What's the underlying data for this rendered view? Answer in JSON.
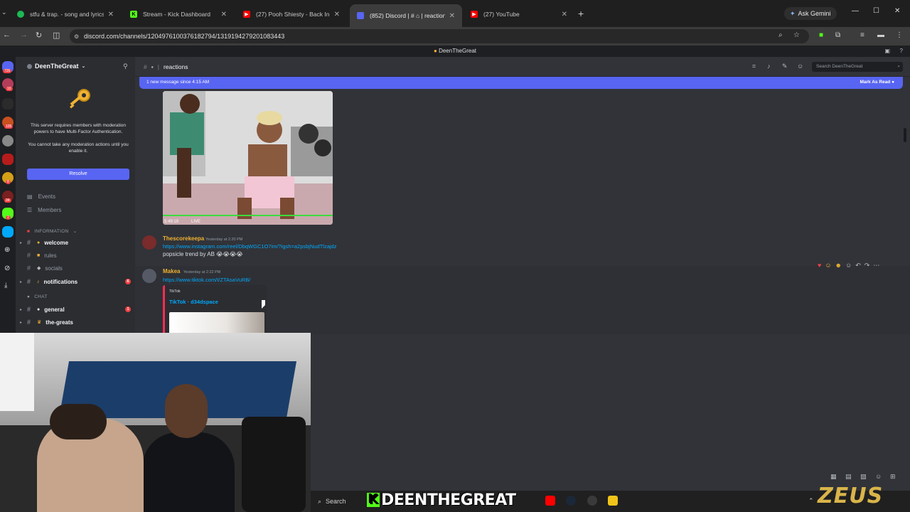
{
  "browser": {
    "tabs": [
      {
        "label": "stfu & trap. - song and lyrics by",
        "color": "#1db954"
      },
      {
        "label": "Stream - Kick Dashboard",
        "color": "#53fc18"
      },
      {
        "label": "(27) Pooh Shiesty - Back In Bloo",
        "color": "#ff0000"
      },
      {
        "label": "(852) Discord | # ⌂ | reactions",
        "color": "#5865f2"
      },
      {
        "label": "(27) YouTube",
        "color": "#ff0000"
      }
    ],
    "new_tab": "+",
    "gemini_label": "Ask Gemini",
    "url": "discord.com/channels/1204976100376182794/1319194279201083443"
  },
  "discord": {
    "window_title": "DeenTheGreat",
    "rail_badges": [
      "726",
      "10",
      "105",
      "8",
      "34",
      "2"
    ],
    "server_name": "DeenTheGreat",
    "mfa_text": "This server requires members with moderation powers to have Multi-Factor Authentication.",
    "mfa_text2": "You cannot take any moderation actions until you enable it.",
    "resolve_label": "Resolve",
    "events_label": "Events",
    "members_label": "Members",
    "categories": {
      "information": "INFORMATION",
      "chat": "CHAT"
    },
    "channels": [
      {
        "name": "welcome",
        "bold": true,
        "icon_color": "#f0b232",
        "mention": ""
      },
      {
        "name": "rules",
        "bold": false,
        "icon_color": "#f0b232",
        "mention": ""
      },
      {
        "name": "socials",
        "bold": false,
        "icon_color": "#b5bac1",
        "mention": ""
      },
      {
        "name": "notifications",
        "bold": true,
        "icon_color": "#f0b232",
        "mention": "6"
      },
      {
        "name": "general",
        "bold": true,
        "icon_color": "#f2f3f5",
        "mention": "1"
      },
      {
        "name": "the-greats",
        "bold": true,
        "icon_color": "#f0b232",
        "mention": ""
      }
    ],
    "channel_header": {
      "name": "reactions",
      "search_placeholder": "Search DeenTheGreat"
    },
    "new_messages_bar": {
      "text": "1 new message since 4:15 AM",
      "action": "Mark As Read"
    },
    "video": {
      "time": "5:49:19",
      "live": "LIVE"
    },
    "messages": [
      {
        "author": "Thescorekeepa",
        "author_color": "#f0b232",
        "time": "Yesterday at 2:20 PM",
        "link": "https://www.instagram.com/reel/DbqWGC1O7im/?igsh=a2psbjNudTlzajdz",
        "text": "popsicle trend by AB 😭😭😭😭"
      },
      {
        "author": "Makea",
        "author_color": "#f0b232",
        "time": "Yesterday at 2:22 PM",
        "link": "https://www.tiktok.com/t/ZTAsaVuRB/",
        "embed_provider": "TikTok",
        "embed_title": "TikTok · d34dspace"
      }
    ]
  },
  "taskbar": {
    "search_label": "Search",
    "overlay_logo": "DEENTHEGREAT",
    "watermark": "ZEUS"
  }
}
